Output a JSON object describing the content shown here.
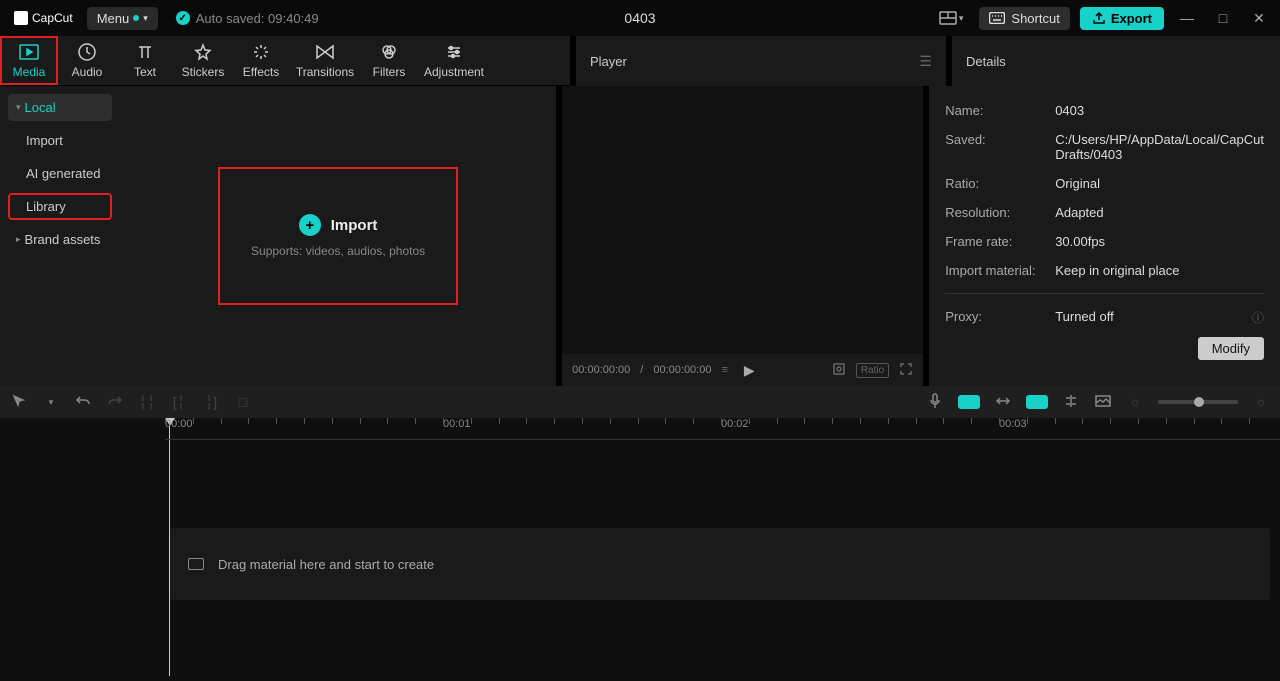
{
  "titlebar": {
    "app_name": "CapCut",
    "menu_label": "Menu",
    "autosave_label": "Auto saved: 09:40:49",
    "project_title": "0403",
    "shortcut_label": "Shortcut",
    "export_label": "Export"
  },
  "tabs": [
    {
      "label": "Media",
      "active": true
    },
    {
      "label": "Audio"
    },
    {
      "label": "Text"
    },
    {
      "label": "Stickers"
    },
    {
      "label": "Effects"
    },
    {
      "label": "Transitions"
    },
    {
      "label": "Filters"
    },
    {
      "label": "Adjustment"
    }
  ],
  "sidebar": {
    "items": [
      {
        "label": "Local",
        "active": true,
        "chev": "▾"
      },
      {
        "label": "Import"
      },
      {
        "label": "AI generated"
      },
      {
        "label": "Library",
        "highlighted": true
      },
      {
        "label": "Brand assets",
        "chev": "▸"
      }
    ]
  },
  "import_area": {
    "title": "Import",
    "subtitle": "Supports: videos, audios, photos"
  },
  "player": {
    "title": "Player",
    "time_current": "00:00:00:00",
    "time_total": "00:00:00:00",
    "ratio_label": "Ratio"
  },
  "details": {
    "title": "Details",
    "rows": [
      {
        "label": "Name:",
        "value": "0403"
      },
      {
        "label": "Saved:",
        "value": "C:/Users/HP/AppData/Local/CapCut Drafts/0403"
      },
      {
        "label": "Ratio:",
        "value": "Original"
      },
      {
        "label": "Resolution:",
        "value": "Adapted"
      },
      {
        "label": "Frame rate:",
        "value": "30.00fps"
      },
      {
        "label": "Import material:",
        "value": "Keep in original place"
      }
    ],
    "proxy_label": "Proxy:",
    "proxy_value": "Turned off",
    "modify_label": "Modify"
  },
  "timeline": {
    "ticks": [
      "00:00",
      "00:01",
      "00:02",
      "00:03"
    ],
    "drop_hint": "Drag material here and start to create"
  }
}
